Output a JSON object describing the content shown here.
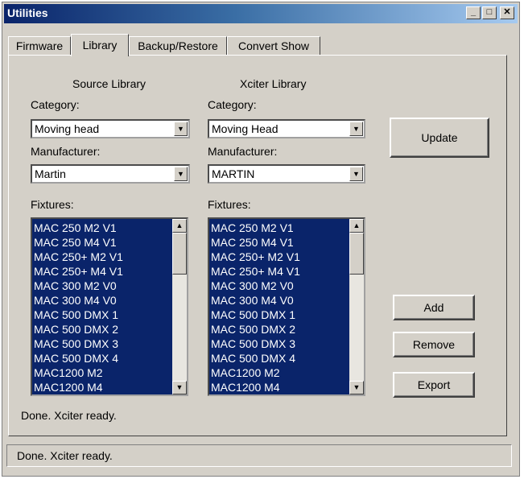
{
  "window": {
    "title": "Utilities"
  },
  "titlebar_buttons": {
    "minimize": "_",
    "maximize": "□",
    "close": "✕"
  },
  "tabs": [
    "Firmware",
    "Library",
    "Backup/Restore",
    "Convert Show"
  ],
  "active_tab": "Library",
  "source": {
    "title": "Source Library",
    "category_label": "Category:",
    "category_value": "Moving head",
    "manufacturer_label": "Manufacturer:",
    "manufacturer_value": "Martin",
    "fixtures_label": "Fixtures:",
    "fixtures": [
      "MAC 250 M2 V1",
      "MAC 250 M4 V1",
      "MAC 250+ M2 V1",
      "MAC 250+ M4 V1",
      "MAC 300 M2 V0",
      "MAC 300 M4 V0",
      "MAC 500 DMX 1",
      "MAC 500 DMX 2",
      "MAC 500 DMX 3",
      "MAC 500 DMX 4",
      "MAC1200 M2",
      "MAC1200 M4"
    ]
  },
  "xciter": {
    "title": "Xciter Library",
    "category_label": "Category:",
    "category_value": "Moving Head",
    "manufacturer_label": "Manufacturer:",
    "manufacturer_value": "MARTIN",
    "fixtures_label": "Fixtures:",
    "fixtures": [
      "MAC 250 M2 V1",
      "MAC 250 M4 V1",
      "MAC 250+ M2 V1",
      "MAC 250+ M4 V1",
      "MAC 300 M2 V0",
      "MAC 300 M4 V0",
      "MAC 500 DMX 1",
      "MAC 500 DMX 2",
      "MAC 500 DMX 3",
      "MAC 500 DMX 4",
      "MAC1200 M2",
      "MAC1200 M4"
    ]
  },
  "buttons": {
    "update": "Update",
    "add": "Add",
    "remove": "Remove",
    "export": "Export"
  },
  "status_message": "Done. Xciter ready.",
  "statusbar_text": "Done. Xciter ready.",
  "colors": {
    "selection": "#0a246a",
    "title_start": "#0a246a",
    "title_end": "#a6caf0",
    "face": "#d4d0c8"
  },
  "icons": {
    "dropdown": "chevron-down-icon",
    "scroll_up": "arrow-up-icon",
    "scroll_down": "arrow-down-icon"
  }
}
